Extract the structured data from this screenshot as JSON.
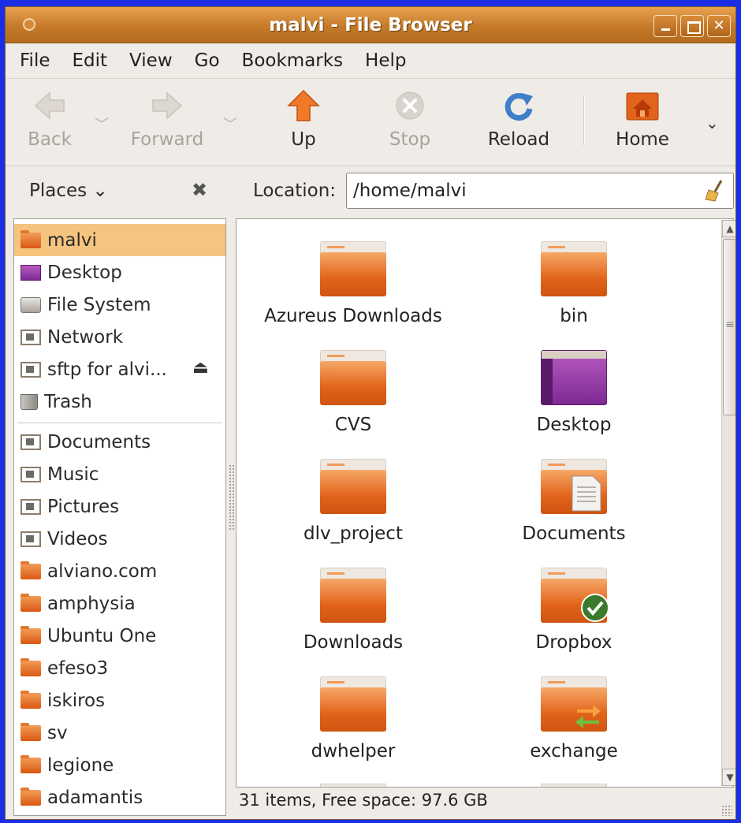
{
  "window": {
    "title": "malvi - File Browser"
  },
  "menu": [
    "File",
    "Edit",
    "View",
    "Go",
    "Bookmarks",
    "Help"
  ],
  "toolbar": {
    "back": "Back",
    "forward": "Forward",
    "up": "Up",
    "stop": "Stop",
    "reload": "Reload",
    "home": "Home"
  },
  "location": {
    "places_label": "Places",
    "label": "Location:",
    "value": "/home/malvi"
  },
  "sidebar": {
    "items": [
      {
        "label": "malvi",
        "icon": "home-folder-icon"
      },
      {
        "label": "Desktop",
        "icon": "desktop-icon"
      },
      {
        "label": "File System",
        "icon": "drive-icon"
      },
      {
        "label": "Network",
        "icon": "network-icon"
      },
      {
        "label": "sftp for alvi...",
        "icon": "network-folder-icon"
      },
      {
        "label": "Trash",
        "icon": "trash-icon"
      },
      {
        "label": "Documents",
        "icon": "documents-icon"
      },
      {
        "label": "Music",
        "icon": "music-icon"
      },
      {
        "label": "Pictures",
        "icon": "pictures-icon"
      },
      {
        "label": "Videos",
        "icon": "videos-icon"
      },
      {
        "label": "alviano.com",
        "icon": "folder-icon"
      },
      {
        "label": "amphysia",
        "icon": "folder-icon"
      },
      {
        "label": "Ubuntu One",
        "icon": "folder-icon"
      },
      {
        "label": "efeso3",
        "icon": "folder-icon"
      },
      {
        "label": "iskiros",
        "icon": "folder-icon"
      },
      {
        "label": "sv",
        "icon": "folder-icon"
      },
      {
        "label": "legione",
        "icon": "folder-icon"
      },
      {
        "label": "adamantis",
        "icon": "folder-icon"
      }
    ]
  },
  "files": [
    {
      "name": "Azureus Downloads",
      "icon": "folder-icon"
    },
    {
      "name": "bin",
      "icon": "folder-icon"
    },
    {
      "name": "CVS",
      "icon": "folder-icon"
    },
    {
      "name": "Desktop",
      "icon": "desktop-folder-icon"
    },
    {
      "name": "dlv_project",
      "icon": "folder-icon"
    },
    {
      "name": "Documents",
      "icon": "documents-folder-icon"
    },
    {
      "name": "Downloads",
      "icon": "folder-icon"
    },
    {
      "name": "Dropbox",
      "icon": "dropbox-synced-folder-icon"
    },
    {
      "name": "dwhelper",
      "icon": "folder-icon"
    },
    {
      "name": "exchange",
      "icon": "shared-folder-icon"
    }
  ],
  "status": "31 items, Free space: 97.6 GB"
}
